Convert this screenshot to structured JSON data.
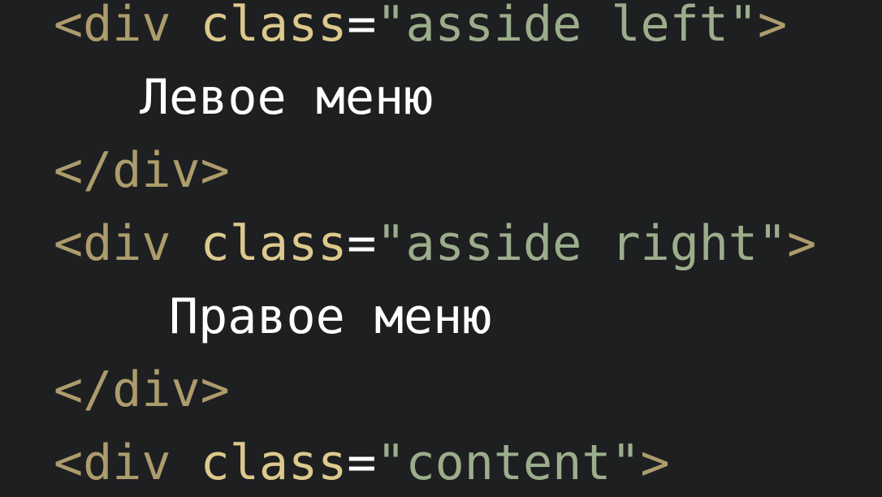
{
  "code": {
    "line1": {
      "open": "<div",
      "attr": "class",
      "eq": "=",
      "value": "\"asside left\"",
      "close": ">"
    },
    "line2": {
      "text": "Левое меню"
    },
    "line3": {
      "closing_tag": "</div>"
    },
    "line4": {
      "open": "<div",
      "attr": "class",
      "eq": "=",
      "value": "\"asside right\"",
      "close": ">"
    },
    "line5": {
      "text": "Правое меню"
    },
    "line6": {
      "closing_tag": "</div>"
    },
    "line7": {
      "open": "<div",
      "attr": "class",
      "eq": "=",
      "value": "\"content\"",
      "close": ">"
    }
  },
  "colors": {
    "background": "#1e1f21",
    "tag": "#ad9c6c",
    "attribute": "#ddc98c",
    "string": "#9cad8c",
    "text": "#ffffff"
  }
}
